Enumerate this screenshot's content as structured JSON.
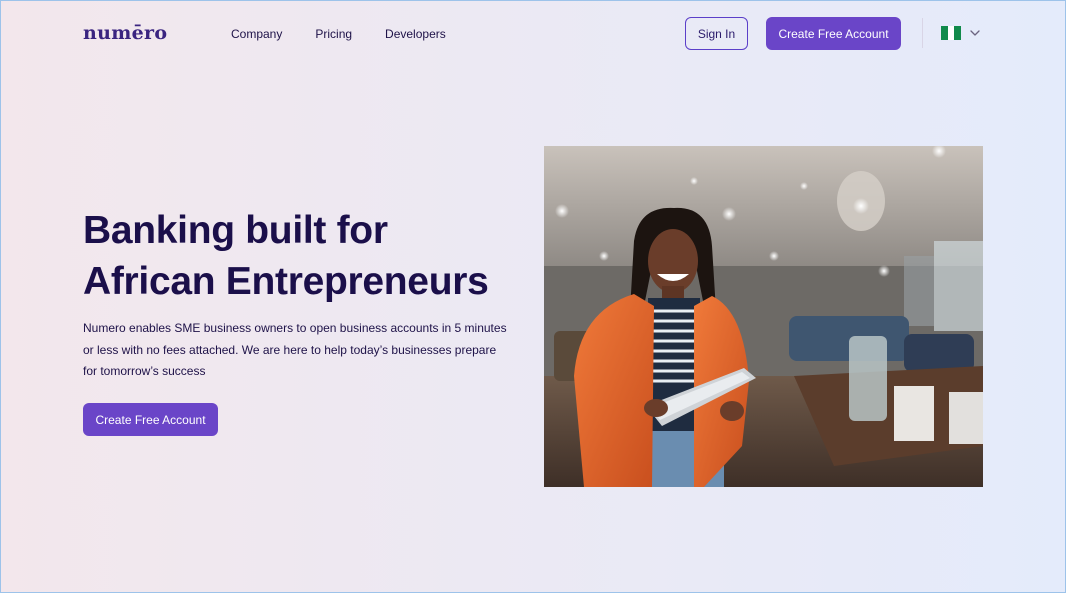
{
  "header": {
    "logo": "numēro",
    "nav": [
      {
        "label": "Company"
      },
      {
        "label": "Pricing"
      },
      {
        "label": "Developers"
      }
    ],
    "sign_in": "Sign In",
    "create_account": "Create Free Account",
    "language_flag": "nigeria-flag-icon"
  },
  "hero": {
    "title_line1": "Banking built for",
    "title_line2": "African Entrepreneurs",
    "description": "Numero enables SME business owners to open business accounts in 5 minutes or less with no fees attached. We are here to help today’s businesses prepare for tomorrow’s success",
    "cta": "Create Free Account",
    "image_alt": "Smiling woman in orange blazer holding a tablet in a furniture store"
  },
  "colors": {
    "brand": "#6a45c8",
    "heading": "#1b0f4a"
  }
}
